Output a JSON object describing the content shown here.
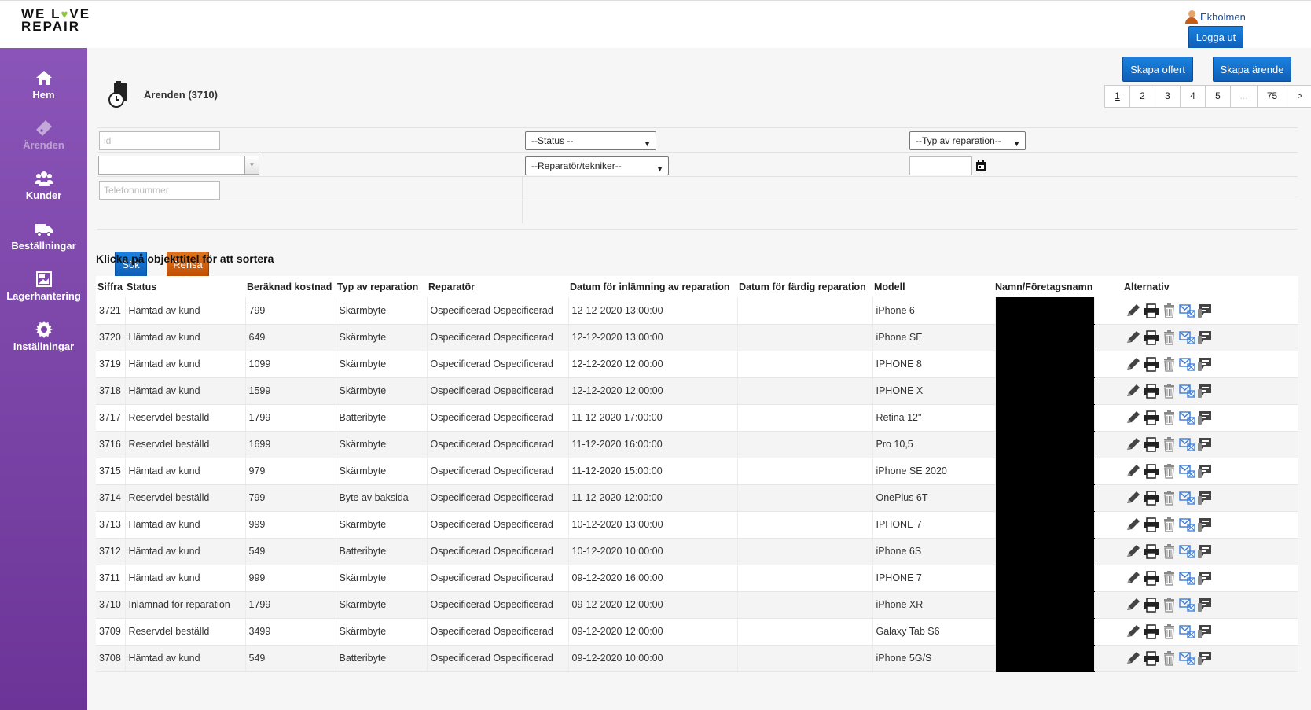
{
  "logo": {
    "line1_a": "WE L",
    "line1_heart": "♥",
    "line1_b": "VE",
    "line2": "REPAIR"
  },
  "user": {
    "name": "Ekholmen",
    "logout_label": "Logga ut"
  },
  "nav": [
    {
      "label": "Hem",
      "icon": "home-icon"
    },
    {
      "label": "Ärenden",
      "icon": "ticket-icon"
    },
    {
      "label": "Kunder",
      "icon": "users-icon"
    },
    {
      "label": "Beställningar",
      "icon": "truck-icon"
    },
    {
      "label": "Lagerhantering",
      "icon": "inventory-icon"
    },
    {
      "label": "Inställningar",
      "icon": "gear-icon"
    }
  ],
  "actions": {
    "create_offer": "Skapa offert",
    "create_case": "Skapa ärende"
  },
  "page": {
    "title": "Ärenden (3710)"
  },
  "pager": {
    "pages": [
      "1",
      "2",
      "3",
      "4",
      "5",
      "...",
      "75",
      ">"
    ],
    "current": "1"
  },
  "filters": {
    "id_placeholder": "id",
    "phone_placeholder": "Telefonnummer",
    "status_label": "--Status --",
    "repair_type_label": "--Typ av reparation--",
    "technician_label": "--Reparatör/tekniker--",
    "search_label": "Sök",
    "clear_label": "Rensa"
  },
  "sort_hint": "Klicka på objekttitel för att sortera",
  "table": {
    "headers": [
      "Siffra",
      "Status",
      "Beräknad kostnad",
      "Typ av reparation",
      "Reparatör",
      "Datum för inlämning av reparation",
      "Datum för färdig reparation",
      "Modell",
      "Namn/Företagsnamn",
      "Alternativ"
    ],
    "rows": [
      [
        "3721",
        "Hämtad av kund",
        "799",
        "Skärmbyte",
        "Ospecificerad Ospecificerad",
        "12-12-2020 13:00:00",
        "",
        "iPhone 6"
      ],
      [
        "3720",
        "Hämtad av kund",
        "649",
        "Skärmbyte",
        "Ospecificerad Ospecificerad",
        "12-12-2020 13:00:00",
        "",
        "iPhone SE"
      ],
      [
        "3719",
        "Hämtad av kund",
        "1099",
        "Skärmbyte",
        "Ospecificerad Ospecificerad",
        "12-12-2020 12:00:00",
        "",
        "IPHONE 8"
      ],
      [
        "3718",
        "Hämtad av kund",
        "1599",
        "Skärmbyte",
        "Ospecificerad Ospecificerad",
        "12-12-2020 12:00:00",
        "",
        "IPHONE X"
      ],
      [
        "3717",
        "Reservdel beställd",
        "1799",
        "Batteribyte",
        "Ospecificerad Ospecificerad",
        "11-12-2020 17:00:00",
        "",
        "Retina 12\""
      ],
      [
        "3716",
        "Reservdel beställd",
        "1699",
        "Skärmbyte",
        "Ospecificerad Ospecificerad",
        "11-12-2020 16:00:00",
        "",
        "Pro 10,5"
      ],
      [
        "3715",
        "Hämtad av kund",
        "979",
        "Skärmbyte",
        "Ospecificerad Ospecificerad",
        "11-12-2020 15:00:00",
        "",
        "iPhone SE 2020"
      ],
      [
        "3714",
        "Reservdel beställd",
        "799",
        "Byte av baksida",
        "Ospecificerad Ospecificerad",
        "11-12-2020 12:00:00",
        "",
        "OnePlus 6T"
      ],
      [
        "3713",
        "Hämtad av kund",
        "999",
        "Skärmbyte",
        "Ospecificerad Ospecificerad",
        "10-12-2020 13:00:00",
        "",
        "IPHONE 7"
      ],
      [
        "3712",
        "Hämtad av kund",
        "549",
        "Batteribyte",
        "Ospecificerad Ospecificerad",
        "10-12-2020 10:00:00",
        "",
        "iPhone 6S"
      ],
      [
        "3711",
        "Hämtad av kund",
        "999",
        "Skärmbyte",
        "Ospecificerad Ospecificerad",
        "09-12-2020 16:00:00",
        "",
        "IPHONE 7"
      ],
      [
        "3710",
        "Inlämnad för reparation",
        "1799",
        "Skärmbyte",
        "Ospecificerad Ospecificerad",
        "09-12-2020 12:00:00",
        "",
        "iPhone XR"
      ],
      [
        "3709",
        "Reservdel beställd",
        "3499",
        "Skärmbyte",
        "Ospecificerad Ospecificerad",
        "09-12-2020 12:00:00",
        "",
        "Galaxy Tab S6"
      ],
      [
        "3708",
        "Hämtad av kund",
        "549",
        "Batteribyte",
        "Ospecificerad Ospecificerad",
        "09-12-2020 10:00:00",
        "",
        "iPhone 5G/S"
      ]
    ],
    "row_action_icons": [
      "edit-icon",
      "print-icon",
      "delete-icon",
      "email-icon",
      "sms-icon"
    ]
  },
  "colors": {
    "sidebar_top": "#8a55b8",
    "sidebar_bottom": "#6c3497",
    "primary_button": "#1a82e0",
    "clear_button": "#e0741a",
    "link": "#1a4fa0"
  }
}
